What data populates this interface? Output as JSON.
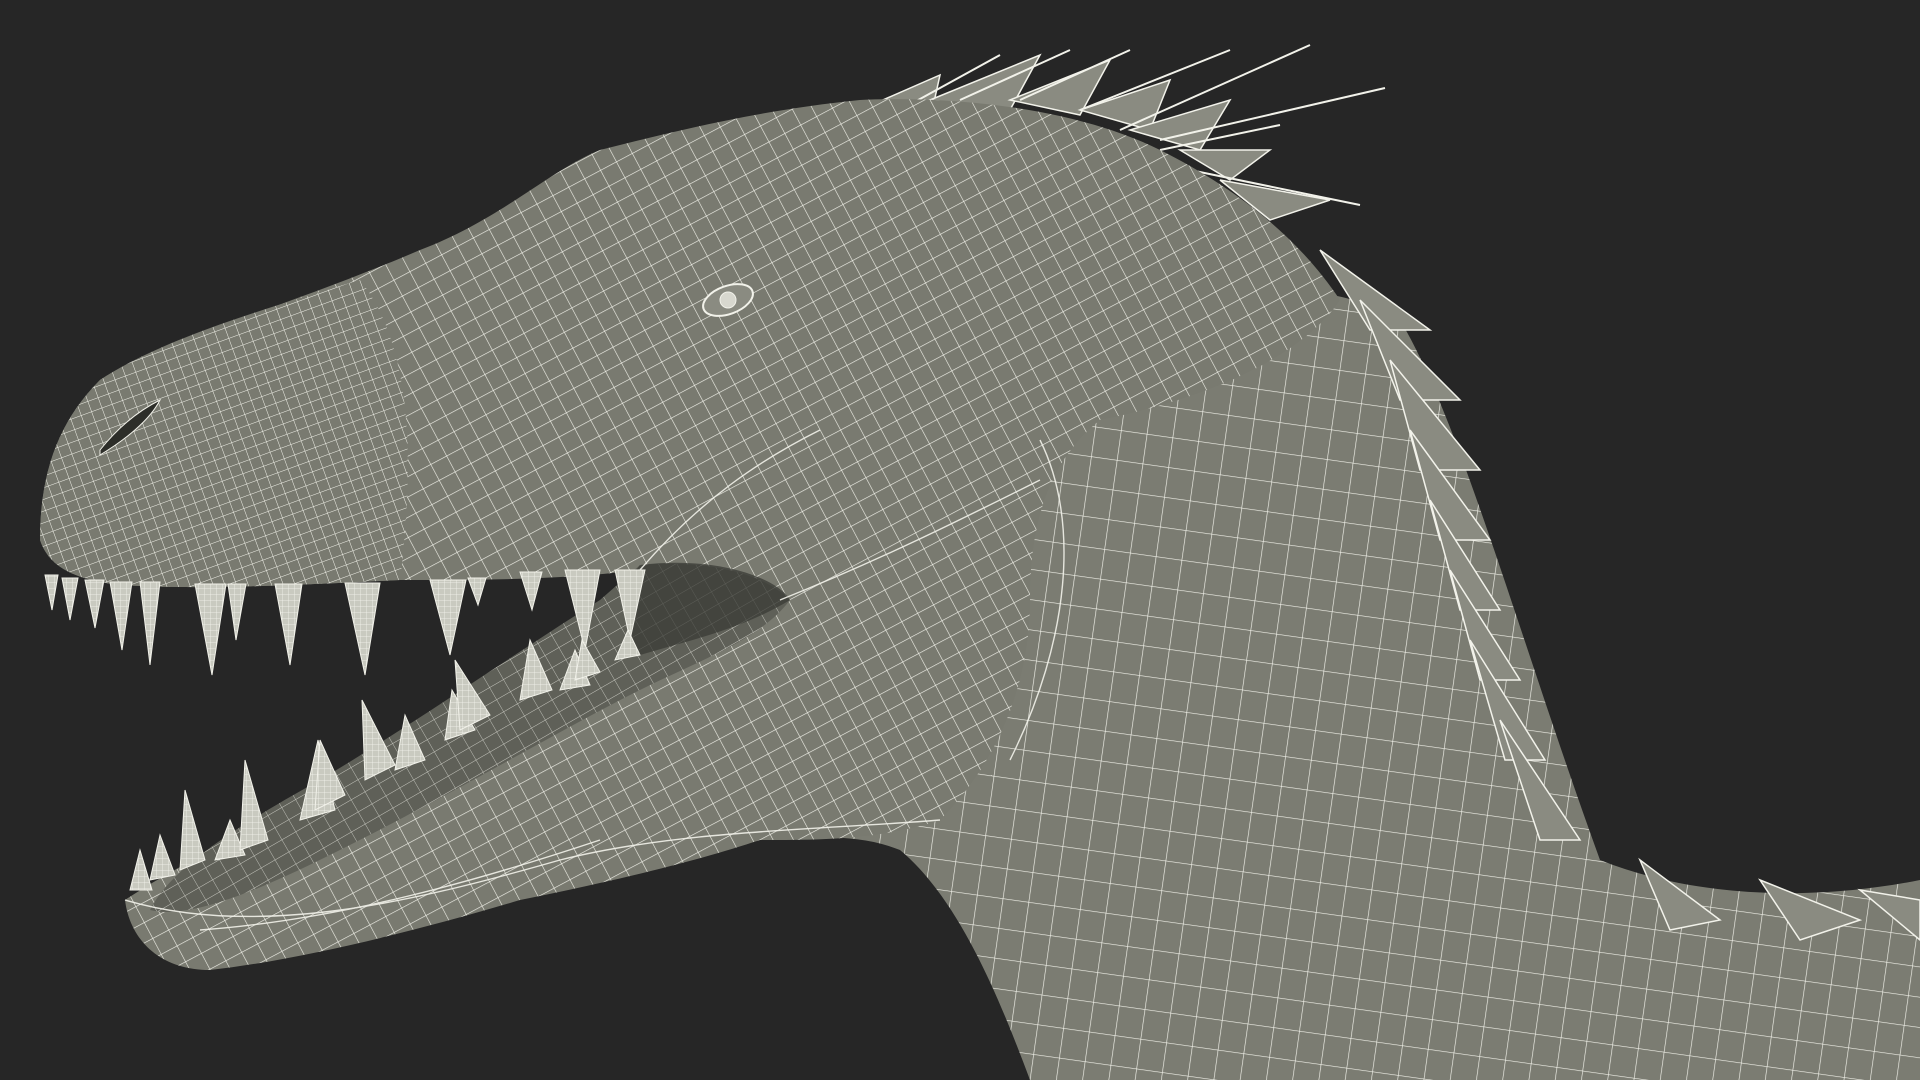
{
  "scene": {
    "subject": "dinosaur-head-wireframe",
    "colors": {
      "background": "#262626",
      "mesh_fill": "#797a70",
      "mesh_fill_dark": "#5f6058",
      "wire": "#f2f2ea",
      "mouth_interior": "#3a3b36",
      "tooth_fill": "#c9cac0"
    }
  }
}
